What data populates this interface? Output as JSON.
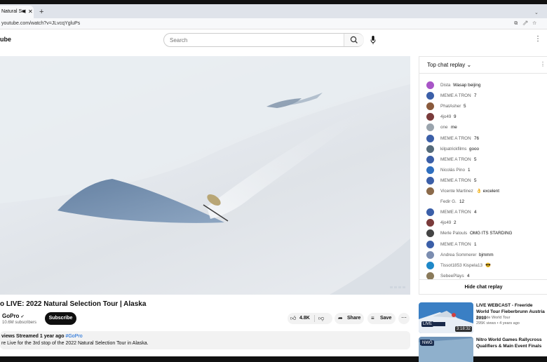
{
  "browser": {
    "tab_title": "Natural Se",
    "tab_audio_icon": "speaker-icon",
    "url": "youtube.com/watch?v=JLvcqYgluPs"
  },
  "masthead": {
    "logo_text": "ube",
    "search_placeholder": "Search"
  },
  "video": {
    "title": "o LIVE: 2022 Natural Selection Tour | Alaska",
    "channel": "GoPro",
    "verified_mark": "✔",
    "subscribers": "10.6M subscribers",
    "subscribe_label": "Subscribe",
    "likes": "4.8K",
    "share_label": "Share",
    "save_label": "Save",
    "desc_views": "views",
    "desc_streamed": "Streamed 1 year ago",
    "desc_tag": "#GoPro",
    "desc_line2": "re Live for the 3rd stop of the 2022 Natural Selection Tour in Alaska."
  },
  "chat": {
    "header": "Top chat replay",
    "messages": [
      {
        "author": "Dista",
        "text": "Wasap beijing",
        "color": "#a855c7"
      },
      {
        "author": "MEME A TRON",
        "text": "7",
        "color": "#3b5fa8"
      },
      {
        "author": "PhatAsher",
        "text": "5",
        "color": "#8a5a3c"
      },
      {
        "author": "4jo49",
        "text": "9",
        "color": "#7a3b3b"
      },
      {
        "author": "one",
        "text": "me",
        "color": "#9aa4ad"
      },
      {
        "author": "MEME A TRON",
        "text": "76",
        "color": "#3b5fa8"
      },
      {
        "author": "kilpatrickfilms",
        "text": "gooo",
        "color": "#556b7a"
      },
      {
        "author": "MEME A TRON",
        "text": "5",
        "color": "#3b5fa8"
      },
      {
        "author": "Nicolás Pino",
        "text": "1",
        "color": "#2f6fbf"
      },
      {
        "author": "MEME A TRON",
        "text": "5",
        "color": "#3b5fa8"
      },
      {
        "author": "Vicente Martinez",
        "text": "👌 excelent",
        "color": "#8b6a4a"
      },
      {
        "author": "Fedir G.",
        "text": "12",
        "color": "#ffffff"
      },
      {
        "author": "MEME A TRON",
        "text": "4",
        "color": "#3b5fa8"
      },
      {
        "author": "4jo49",
        "text": "2",
        "color": "#7a3b3b"
      },
      {
        "author": "Merle Palouls",
        "text": "OMG ITS STARDING",
        "color": "#444444"
      },
      {
        "author": "MEME A TRON",
        "text": "1",
        "color": "#3b5fa8"
      },
      {
        "author": "Andrea Sommerer",
        "text": "bjmmm",
        "color": "#7b8db0"
      },
      {
        "author": "Tissot1853 Kispela13",
        "text": "😎",
        "color": "#1e88c8"
      },
      {
        "author": "SebeePlays",
        "text": "4",
        "color": "#8a7a5a"
      }
    ],
    "hide_label": "Hide chat replay"
  },
  "recommendations": [
    {
      "title": "LIVE WEBCAST - Freeride World Tour Fieberbrunn Austria 2019",
      "channel": "Freeride World Tour",
      "meta": "295K views • 4 years ago",
      "duration": "3:18:32",
      "badge": "LIVE"
    },
    {
      "title": "Nitro World Games Rallycross Qualifiers & Main Event Finals",
      "channel": "",
      "meta": "",
      "duration": "",
      "badge": "NWG"
    }
  ]
}
